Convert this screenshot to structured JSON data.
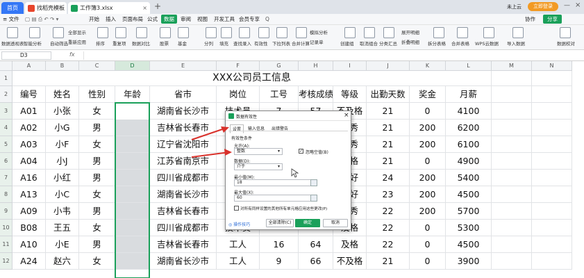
{
  "tabs": [
    {
      "label": "首页",
      "active": true
    },
    {
      "label": "找稻壳模板",
      "active": false
    },
    {
      "label": "工作簿3.xlsx",
      "active": false
    }
  ],
  "titlebar": {
    "new_tab": "+",
    "user": "未上云",
    "vip": "立即登录"
  },
  "menu": {
    "file": "文件",
    "items": [
      "开始",
      "插入",
      "页面布局",
      "公式",
      "数据",
      "审阅",
      "视图",
      "开发工具",
      "会员专享"
    ],
    "active": "数据",
    "right": [
      "分享",
      "协作"
    ],
    "search": "Q"
  },
  "ribbon": [
    "数据透视表",
    "智能分析",
    "自动筛选",
    "全部显示",
    "重新应用",
    "排序",
    "重复项",
    "数据对比",
    "股票",
    "基金",
    "分列",
    "填充",
    "查找录入",
    "有效性",
    "下拉列表",
    "合并计算",
    "模拟分析",
    "记录单",
    "创建组",
    "取消组合",
    "分类汇总",
    "展开明细",
    "折叠明细",
    "拆分表格",
    "合并表格",
    "WPS云数据",
    "导入数据",
    "数据校对"
  ],
  "formula_bar": {
    "cell_ref": "D3",
    "fx": "fx",
    "value": ""
  },
  "columns": [
    "A",
    "B",
    "C",
    "D",
    "E",
    "F",
    "G",
    "H",
    "I",
    "J",
    "K",
    "L",
    "M",
    "N"
  ],
  "rows": [
    "1",
    "2",
    "3",
    "4",
    "5",
    "6",
    "7",
    "8",
    "9",
    "10",
    "11",
    "12"
  ],
  "sheet": {
    "title": "XXX公司员工信息",
    "headers": [
      "编号",
      "姓名",
      "性别",
      "年龄",
      "省市",
      "岗位",
      "工号",
      "考核成绩",
      "等级",
      "出勤天数",
      "奖金",
      "月薪"
    ],
    "data": [
      [
        "A01",
        "小张",
        "女",
        "",
        "湖南省长沙市",
        "技术员",
        "7",
        "57",
        "不及格",
        "21",
        "0",
        "4100"
      ],
      [
        "A02",
        "小G",
        "男",
        "",
        "吉林省长春市",
        "",
        "",
        "",
        "优秀",
        "21",
        "200",
        "6200"
      ],
      [
        "A03",
        "小F",
        "女",
        "",
        "辽宁省沈阳市",
        "",
        "",
        "",
        "优秀",
        "21",
        "200",
        "6100"
      ],
      [
        "A04",
        "小J",
        "男",
        "",
        "江苏省南京市",
        "",
        "",
        "",
        "及格",
        "21",
        "0",
        "4900"
      ],
      [
        "A16",
        "小红",
        "男",
        "",
        "四川省成都市",
        "",
        "",
        "",
        "良好",
        "24",
        "200",
        "5400"
      ],
      [
        "A13",
        "小C",
        "女",
        "",
        "湖南省长沙市",
        "",
        "",
        "",
        "良好",
        "23",
        "200",
        "4500"
      ],
      [
        "A09",
        "小韦",
        "男",
        "",
        "吉林省长春市",
        "",
        "",
        "",
        "优秀",
        "22",
        "200",
        "5700"
      ],
      [
        "B08",
        "王五",
        "女",
        "",
        "四川省成都市",
        "技术员",
        "",
        "",
        "及格",
        "22",
        "0",
        "5300"
      ],
      [
        "A10",
        "小E",
        "男",
        "",
        "吉林省长春市",
        "工人",
        "16",
        "64",
        "及格",
        "22",
        "0",
        "4500"
      ],
      [
        "A24",
        "赵六",
        "女",
        "",
        "湖南省长沙市",
        "工人",
        "9",
        "66",
        "不及格",
        "21",
        "0",
        "3900"
      ]
    ]
  },
  "dialog": {
    "title": "数据有效性",
    "tabs": [
      "设置",
      "输入信息",
      "出错警告"
    ],
    "section": "有效性条件",
    "allow_label": "允许(A):",
    "allow_value": "整数",
    "ignore_blank": "忽略空值(B)",
    "data_label": "数据(D):",
    "data_value": "介于",
    "min_label": "最小值(M):",
    "min_value": "18",
    "max_label": "最大值(X):",
    "max_value": "60",
    "apply_all": "对所有同样设置的其他所有单元格应用这些更改(P)",
    "tips": "操作技巧",
    "clear": "全部清除(C)",
    "ok": "确定",
    "cancel": "取消"
  },
  "colors": {
    "accent": "#1aa05a",
    "highlight_col": "#d9dcdf",
    "arrow": "#d9312b",
    "tabbar": "#dfe3e9"
  }
}
